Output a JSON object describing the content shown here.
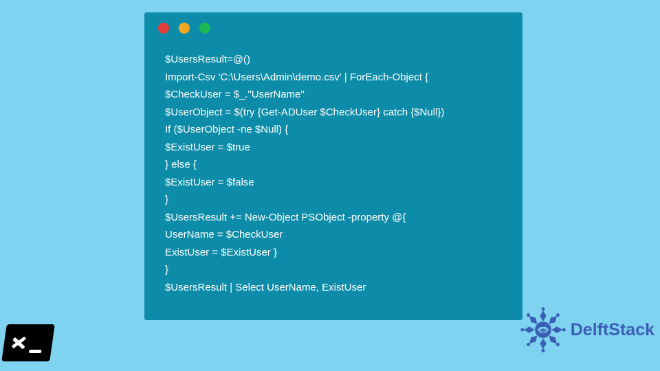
{
  "code": {
    "lines": [
      "$UsersResult=@()",
      "Import-Csv 'C:\\Users\\Admin\\demo.csv' | ForEach-Object {",
      "$CheckUser = $_.\"UserName\"",
      "$UserObject = $(try {Get-ADUser $CheckUser} catch {$Null})",
      "If ($UserObject -ne $Null) {",
      "$ExistUser = $true",
      "} else {",
      "$ExistUser = $false",
      "}",
      "$UsersResult += New-Object PSObject -property @{",
      "UserName = $CheckUser",
      "ExistUser = $ExistUser }",
      "}",
      "$UsersResult | Select UserName, ExistUser"
    ]
  },
  "brand": {
    "name": "DelftStack"
  },
  "colors": {
    "background": "#7fd3f0",
    "codeBackground": "#0d8ca9",
    "brandBlue": "#3a5fb5"
  }
}
